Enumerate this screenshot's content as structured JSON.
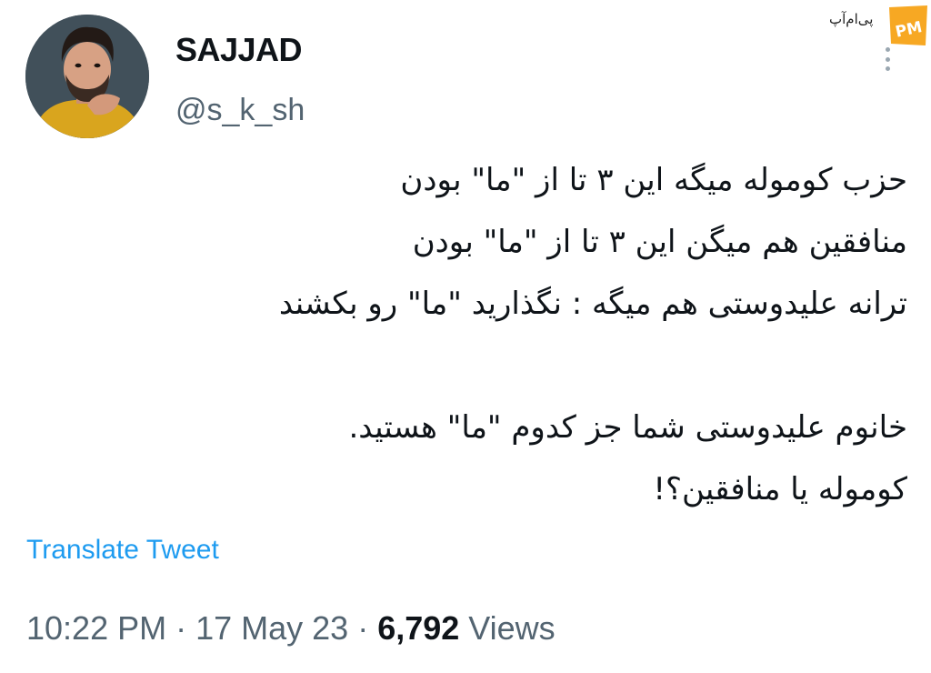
{
  "watermark": {
    "brand_text": "پی‌ام‌آپ",
    "logo_text": "PM",
    "logo_color": "#f7a823"
  },
  "author": {
    "display_name": "SAJJAD",
    "handle": "@s_k_sh"
  },
  "tweet": {
    "lines": [
      "حزب کومولە میگه این ۳ تا از \"ما\" بودن",
      "منافقین هم میگن این ۳ تا از \"ما\" بودن",
      "ترانه علیدوستی هم میگه : نگذارید \"ما\" رو بکشند",
      "",
      "خانوم علیدوستی شما جز کدوم \"ما\" هستید.",
      "کومولە یا منافقین؟!"
    ]
  },
  "translate_label": "Translate Tweet",
  "meta": {
    "time": "10:22 PM",
    "sep1": " · ",
    "date": "17 May 23",
    "sep2": " · ",
    "views_count": "6,792",
    "views_label": " Views"
  },
  "colors": {
    "text": "#0f1419",
    "secondary": "#536471",
    "link": "#1d9bf0"
  },
  "icons": {
    "avatar": "user-avatar",
    "more": "more-options-icon"
  }
}
